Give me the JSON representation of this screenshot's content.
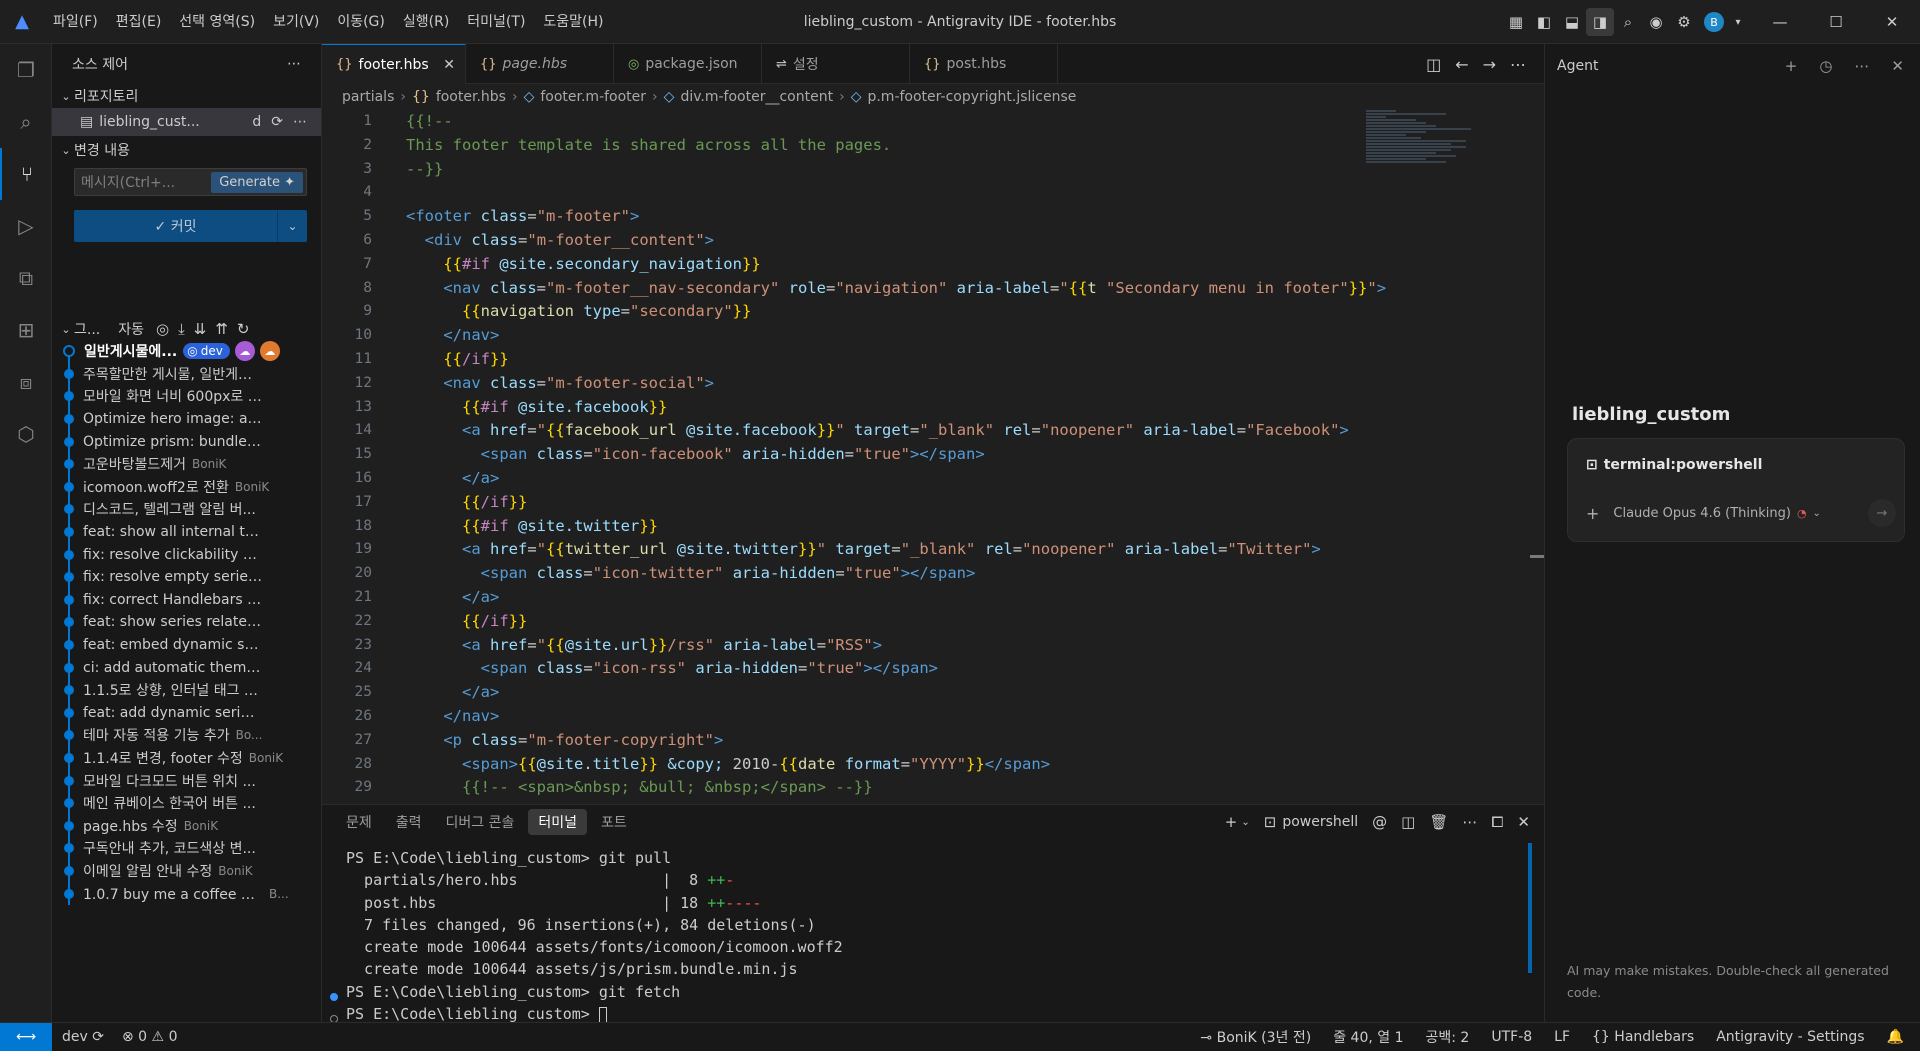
{
  "titlebar": {
    "menus": [
      "파일(F)",
      "편집(E)",
      "선택 영역(S)",
      "보기(V)",
      "이동(G)",
      "실행(R)",
      "터미널(T)",
      "도움말(H)"
    ],
    "title": "liebling_custom - Antigravity IDE - footer.hbs",
    "avatar_letter": "B"
  },
  "sidebar": {
    "title": "소스 제어",
    "repo_section": "리포지토리",
    "repo_name": "liebling_cust...",
    "repo_status": "d",
    "changes_section": "변경 내용",
    "message_placeholder": "메시지(Ctrl+...",
    "generate_label": "Generate",
    "commit_label": "✓ 커밋",
    "graph_label": "그...",
    "graph_auto": "자동",
    "graph_items": [
      {
        "text": "일반게시물에...",
        "author": "",
        "head": true
      },
      {
        "text": "주목할만한 게시물, 일반게시...",
        "author": ""
      },
      {
        "text": "모바일 화면 너비 600px로 고...",
        "author": ""
      },
      {
        "text": "Optimize hero image: add u...",
        "author": ""
      },
      {
        "text": "Optimize prism: bundle into ...",
        "author": ""
      },
      {
        "text": "고운바탕볼드제거",
        "author": "BoniK"
      },
      {
        "text": "icomoon.woff2로 전환",
        "author": "BoniK"
      },
      {
        "text": "디스코드, 텔레그램 알림 버...",
        "author": ""
      },
      {
        "text": "feat: show all internal tags re...",
        "author": ""
      },
      {
        "text": "fix: resolve clickability of seri...",
        "author": ""
      },
      {
        "text": "fix: resolve empty series slug...",
        "author": ""
      },
      {
        "text": "fix: correct Handlebars conte...",
        "author": ""
      },
      {
        "text": "feat: show series related post...",
        "author": ""
      },
      {
        "text": "feat: embed dynamic series ...",
        "author": ""
      },
      {
        "text": "ci: add automatic theme acti...",
        "author": ""
      },
      {
        "text": "1.1.5로 상향, 인터널 태그 페...",
        "author": ""
      },
      {
        "text": "feat: add dynamic series pag...",
        "author": ""
      },
      {
        "text": "테마 자동 적용 기능 추가",
        "author": "Bo..."
      },
      {
        "text": "1.1.4로 변경, footer 수정",
        "author": "BoniK"
      },
      {
        "text": "모바일 다크모드 버튼 위치 ...",
        "author": ""
      },
      {
        "text": "메인 큐베이스 한국어 버튼 ...",
        "author": ""
      },
      {
        "text": "page.hbs 수정",
        "author": "BoniK"
      },
      {
        "text": "구독안내 추가, 코드색상 변...",
        "author": ""
      },
      {
        "text": "이메일 알림 안내 수정",
        "author": "BoniK"
      },
      {
        "text": "1.0.7 buy me a coffee 추가",
        "author": "B..."
      }
    ],
    "branch_badge": "dev"
  },
  "editor": {
    "tabs": [
      {
        "label": "footer.hbs",
        "icon": "{}",
        "active": true,
        "italic": false
      },
      {
        "label": "page.hbs",
        "icon": "{}",
        "active": false,
        "italic": true
      },
      {
        "label": "package.json",
        "icon": "json",
        "active": false,
        "italic": false
      },
      {
        "label": "설정",
        "icon": "gear",
        "active": false,
        "italic": false
      },
      {
        "label": "post.hbs",
        "icon": "{}",
        "active": false,
        "italic": false
      }
    ],
    "breadcrumb": [
      "partials",
      "footer.hbs",
      "footer.m-footer",
      "div.m-footer__content",
      "p.m-footer-copyright.jslicense"
    ],
    "line_numbers": [
      "1",
      "2",
      "3",
      "4",
      "5",
      "6",
      "7",
      "8",
      "9",
      "10",
      "11",
      "12",
      "13",
      "14",
      "15",
      "16",
      "17",
      "18",
      "19",
      "20",
      "21",
      "22",
      "23",
      "24",
      "25",
      "26",
      "27",
      "28",
      "29"
    ]
  },
  "panel": {
    "tabs": [
      "문제",
      "출력",
      "디버그 콘솔",
      "터미널",
      "포트"
    ],
    "active_tab": "터미널",
    "shell": "powershell",
    "terminal_lines": [
      "PS E:\\Code\\liebling_custom> git pull",
      "  partials/hero.hbs                |  8 ++-",
      "  post.hbs                         | 18 ++----",
      "  7 files changed, 96 insertions(+), 84 deletions(-)",
      "  create mode 100644 assets/fonts/icomoon/icomoon.woff2",
      "  create mode 100644 assets/js/prism.bundle.min.js",
      "PS E:\\Code\\liebling_custom> git fetch",
      "PS E:\\Code\\liebling_custom> "
    ]
  },
  "agent": {
    "title": "Agent",
    "workspace": "liebling_custom",
    "card_title": "terminal:powershell",
    "model": "Claude Opus 4.6 (Thinking)",
    "note": "AI may make mistakes. Double-check all generated code."
  },
  "statusbar": {
    "branch": "dev",
    "problems_errors": "0",
    "problems_warnings": "0",
    "blame": "BoniK (3년 전)",
    "cursor": "줄 40, 열 1",
    "indent": "공백: 2",
    "encoding": "UTF-8",
    "eol": "LF",
    "language": "Handlebars",
    "settings": "Antigravity - Settings"
  },
  "colors": {
    "accent": "#0078d4",
    "background": "#1f1f1f"
  }
}
